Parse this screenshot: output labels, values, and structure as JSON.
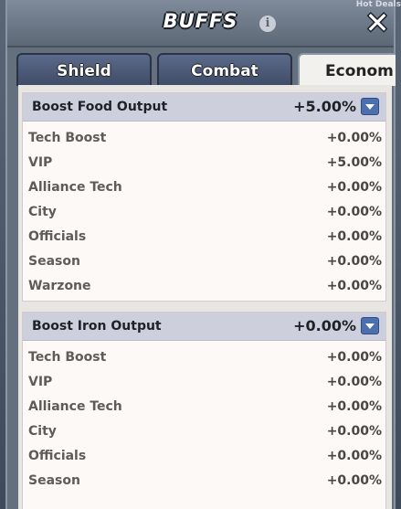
{
  "backdrop": {
    "corner_text": "Hot Deals"
  },
  "dialog": {
    "title": "BUFFS",
    "info_icon": "info-icon",
    "close_icon": "close-icon"
  },
  "tabs": [
    {
      "label": "Shield",
      "active": false
    },
    {
      "label": "Combat",
      "active": false
    },
    {
      "label": "Econom",
      "active": true
    }
  ],
  "sections": [
    {
      "title": "Boost Food Output",
      "total": "+5.00%",
      "rows": [
        {
          "label": "Tech Boost",
          "value": "+0.00%"
        },
        {
          "label": "VIP",
          "value": "+5.00%"
        },
        {
          "label": "Alliance Tech",
          "value": "+0.00%"
        },
        {
          "label": "City",
          "value": "+0.00%"
        },
        {
          "label": "Officials",
          "value": "+0.00%"
        },
        {
          "label": "Season",
          "value": "+0.00%"
        },
        {
          "label": "Warzone",
          "value": "+0.00%"
        }
      ]
    },
    {
      "title": "Boost Iron Output",
      "total": "+0.00%",
      "rows": [
        {
          "label": "Tech Boost",
          "value": "+0.00%"
        },
        {
          "label": "VIP",
          "value": "+0.00%"
        },
        {
          "label": "Alliance Tech",
          "value": "+0.00%"
        },
        {
          "label": "City",
          "value": "+0.00%"
        },
        {
          "label": "Officials",
          "value": "+0.00%"
        },
        {
          "label": "Season",
          "value": "+0.00%"
        }
      ]
    }
  ]
}
